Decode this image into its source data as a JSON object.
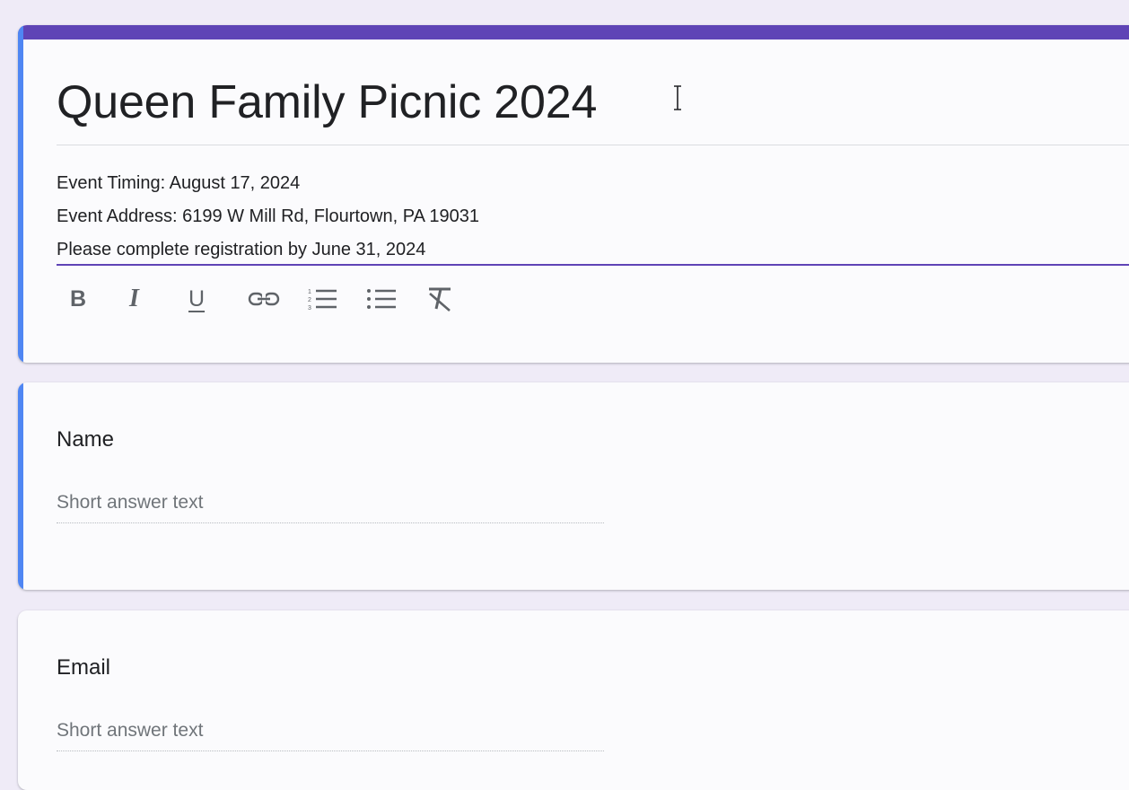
{
  "form": {
    "title": "Queen Family Picnic 2024",
    "description_lines": [
      "Event Timing: August 17, 2024",
      "Event Address: 6199 W Mill Rd, Flourtown, PA 19031",
      "Please complete registration by June 31, 2024"
    ]
  },
  "toolbar": {
    "bold_label": "B",
    "italic_label": "I",
    "underline_label": "U",
    "icons": [
      "bold-icon",
      "italic-icon",
      "underline-icon",
      "link-icon",
      "numbered-list-icon",
      "bulleted-list-icon",
      "clear-formatting-icon"
    ]
  },
  "questions": [
    {
      "title": "Name",
      "placeholder": "Short answer text"
    },
    {
      "title": "Email",
      "placeholder": "Short answer text"
    }
  ],
  "colors": {
    "accent": "#5f44b6",
    "focus_bar": "#4f86f3",
    "background": "#efebf7"
  }
}
